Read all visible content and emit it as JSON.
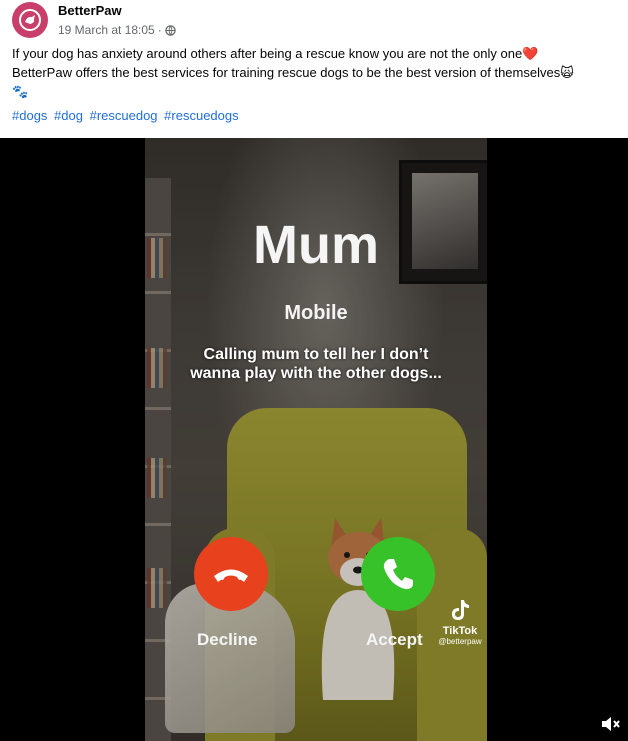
{
  "post": {
    "author": "BetterPaw",
    "date": "19 March at 18:05",
    "separator": "·",
    "text_line1": "If your dog has anxiety around others after being a rescue know you are not the only one❤️",
    "text_line2": "BetterPaw offers the best services for training rescue dogs to be the best version of themselves🙀",
    "text_line3": "🐾",
    "hashtags": [
      "#dogs",
      "#dog",
      "#rescuedog",
      "#rescuedogs"
    ]
  },
  "video": {
    "caller_name": "Mum",
    "caller_type": "Mobile",
    "caption_line1": "Calling mum to tell her I don’t",
    "caption_line2": "wanna play with the other dogs...",
    "decline_label": "Decline",
    "accept_label": "Accept",
    "watermark_name": "TikTok",
    "watermark_handle": "@betterpaw"
  },
  "colors": {
    "avatar_bg": "#c93f6b",
    "hashtag": "#216fdb",
    "decline": "#e8411d",
    "accept": "#37c22a"
  },
  "icons": {
    "globe": "globe-icon",
    "decline": "phone-hangup-icon",
    "accept": "phone-icon",
    "mute": "speaker-muted-icon"
  }
}
